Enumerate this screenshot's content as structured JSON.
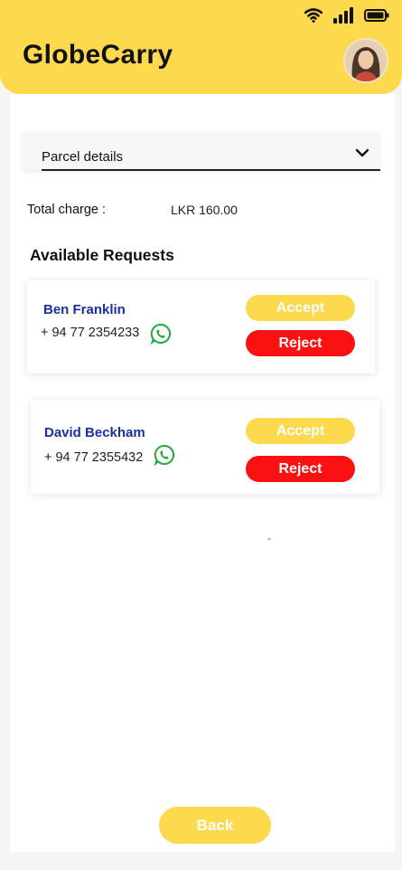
{
  "app": {
    "title": "GlobeCarry"
  },
  "parcel": {
    "dropdown_label": "Parcel details"
  },
  "total": {
    "label": "Total charge :",
    "value": "LKR 160.00"
  },
  "requests_section": {
    "title": "Available Requests"
  },
  "requests": [
    {
      "name": "Ben Franklin",
      "phone": "+ 94 77 2354233",
      "accept_label": "Accept",
      "reject_label": "Reject"
    },
    {
      "name": "David Beckham",
      "phone": "+ 94 77 2355432",
      "accept_label": "Accept",
      "reject_label": "Reject"
    }
  ],
  "placeholder_dash": "-",
  "back_button": {
    "label": "Back"
  },
  "colors": {
    "accent": "#fdd94e",
    "reject": "#fa1212",
    "name": "#1b2fa0",
    "whatsapp": "#1faa3a"
  },
  "icons": [
    "wifi-icon",
    "signal-icon",
    "battery-icon",
    "chevron-down-icon",
    "whatsapp-icon"
  ]
}
